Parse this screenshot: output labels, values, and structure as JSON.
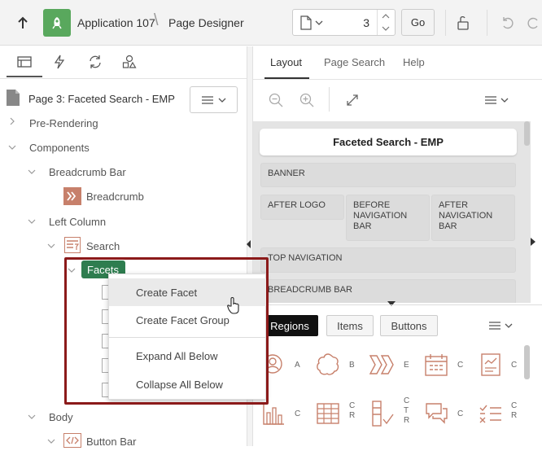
{
  "header": {
    "app_name": "Application 107",
    "separator": "\\",
    "title": "Page Designer",
    "page_number": "3",
    "go_label": "Go"
  },
  "left": {
    "page_title": "Page 3: Faceted Search - EMP",
    "tree": {
      "pre_rendering": "Pre-Rendering",
      "components": "Components",
      "breadcrumb_bar": "Breadcrumb Bar",
      "breadcrumb": "Breadcrumb",
      "left_column": "Left Column",
      "search": "Search",
      "facets": "Facets",
      "body": "Body",
      "button_bar": "Button Bar"
    }
  },
  "context_menu": {
    "items": [
      "Create Facet",
      "Create Facet Group",
      "Expand All Below",
      "Collapse All Below"
    ]
  },
  "right": {
    "tabs": [
      "Layout",
      "Page Search",
      "Help"
    ],
    "active_tab": "Layout",
    "layout": {
      "page_label": "Faceted Search - EMP",
      "banner": "BANNER",
      "after_logo": "AFTER LOGO",
      "before_navigation_bar": "BEFORE NAVIGATION BAR",
      "after_navigation_bar": "AFTER NAVIGATION BAR",
      "top_navigation": "TOP NAVIGATION",
      "breadcrumb_bar": "BREADCRUMB BAR"
    },
    "gallery_tabs": [
      "Regions",
      "Items",
      "Buttons"
    ],
    "gallery_labels": {
      "r1": [
        "A",
        "B",
        "E",
        "C",
        "C"
      ],
      "r2": [
        "C",
        "C R",
        "C T R",
        "C",
        "C R"
      ]
    }
  },
  "colors": {
    "accent_green": "#2e7d4f",
    "app_tile": "#59a85d",
    "highlight_border": "#8b1a1a",
    "region_icon": "#c7806b"
  }
}
